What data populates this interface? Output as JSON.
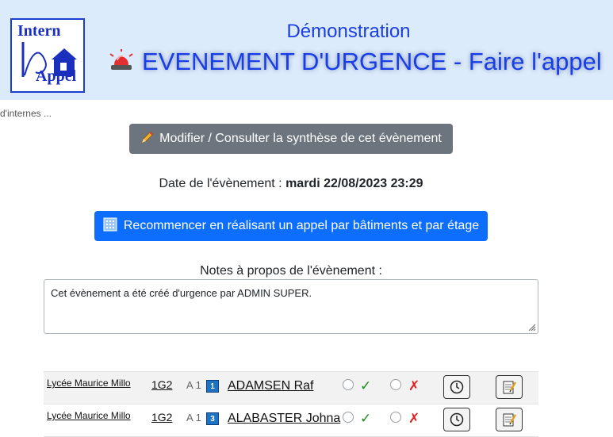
{
  "header": {
    "logo_top": "ntern",
    "logo_bottom": "ppel",
    "logo_letters": "I A",
    "demo_title": "Démonstration",
    "main_title": "EVENEMENT D'URGENCE - Faire l'appel"
  },
  "breadcrumb": "d'internes ...",
  "buttons": {
    "edit_label": "Modifier / Consulter la synthèse de cet évènement",
    "restart_label": "Recommencer en réalisant un appel par bâtiments et par étage"
  },
  "event": {
    "date_label": "Date de l'évènement :",
    "date_value": "mardi 22/08/2023 23:29"
  },
  "notes": {
    "label": "Notes à propos de l'évènement :",
    "value": "Cet évènement a été créé d'urgence par ADMIN SUPER."
  },
  "students": [
    {
      "school": "Lycée Maurice Millo",
      "class": "1G2",
      "building": "A 1",
      "floor": "1",
      "name": "ADAMSEN Raf",
      "present_mark": "✓",
      "absent_mark": "✗"
    },
    {
      "school": "Lycée Maurice Millo",
      "class": "1G2",
      "building": "A 1",
      "floor": "3",
      "name": "ALABASTER Johna",
      "present_mark": "✓",
      "absent_mark": "✗"
    }
  ],
  "colors": {
    "header_bg": "#dcebfb",
    "title_blue": "#1a3ee6",
    "btn_gray": "#6c757d",
    "btn_blue": "#0d6efd",
    "floor_badge": "#1f73c4"
  },
  "icons": [
    "siren-icon",
    "pencil-icon",
    "building-icon",
    "clock-icon",
    "notepad-icon",
    "resize-handle-icon"
  ]
}
